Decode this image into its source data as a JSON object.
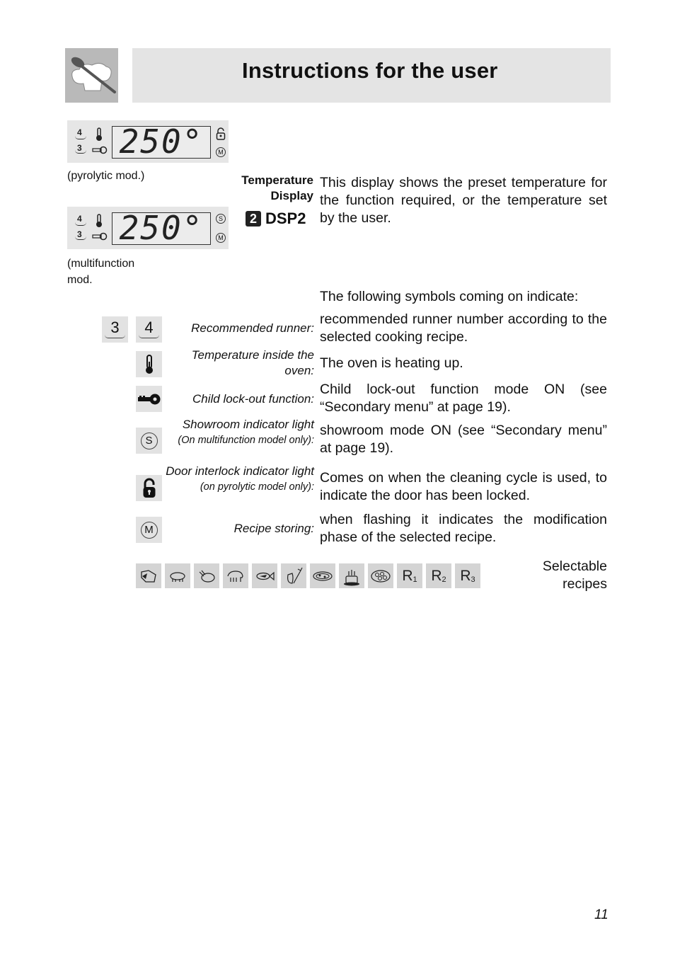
{
  "header": {
    "title": "Instructions for the user",
    "logo": "chef-hat-spoon-icon"
  },
  "displays": [
    {
      "caption": "(pyrolytic mod.)",
      "value": "250°",
      "runner_top": "4",
      "runner_bottom": "3",
      "right_icons": [
        "padlock-icon",
        "M"
      ]
    },
    {
      "caption": "(multifunction mod.)",
      "caption_lines": [
        "(multifunction",
        "mod."
      ],
      "value": "250°",
      "runner_top": "4",
      "runner_bottom": "3",
      "right_icons": [
        "S",
        "M"
      ]
    }
  ],
  "temperature_display": {
    "label_line1": "Temperature",
    "label_line2": "Display",
    "badge_number": "2",
    "code": "DSP2",
    "description": "This display shows the preset temperature for the function required, or the temperature set by the user."
  },
  "symbols_intro": "The following symbols coming on indicate:",
  "symbols": [
    {
      "icons": [
        "3",
        "4"
      ],
      "label": "Recommended runner:",
      "description": "recommended runner number according to the selected cooking recipe."
    },
    {
      "icons": [
        "thermometer-icon"
      ],
      "label": "Temperature inside the oven:",
      "description": "The oven is heating up."
    },
    {
      "icons": [
        "key-icon"
      ],
      "label": "Child lock-out function:",
      "description": "Child lock-out function mode ON (see “Secondary menu” at page 19)."
    },
    {
      "icons": [
        "S"
      ],
      "label": "Showroom indicator light",
      "sublabel": "(On multifunction model only):",
      "description": "showroom mode ON (see “Secondary menu” at page 19)."
    },
    {
      "icons": [
        "padlock-icon"
      ],
      "label": "Door interlock indicator light",
      "sublabel": "(on pyrolytic model only):",
      "description": "Comes on when the cleaning cycle is used, to indicate the door has been locked."
    },
    {
      "icons": [
        "M"
      ],
      "label": "Recipe storing:",
      "description": "when flashing it indicates the modification phase of the selected recipe."
    }
  ],
  "recipes": {
    "label_line1": "Selectable",
    "label_line2": "recipes",
    "icons": [
      "beef",
      "pork",
      "poultry",
      "lamb",
      "fish",
      "vegetables",
      "pizza",
      "cake",
      "biscuits"
    ],
    "custom": [
      {
        "letter": "R",
        "sub": "1"
      },
      {
        "letter": "R",
        "sub": "2"
      },
      {
        "letter": "R",
        "sub": "3"
      }
    ]
  },
  "page_number": "11"
}
